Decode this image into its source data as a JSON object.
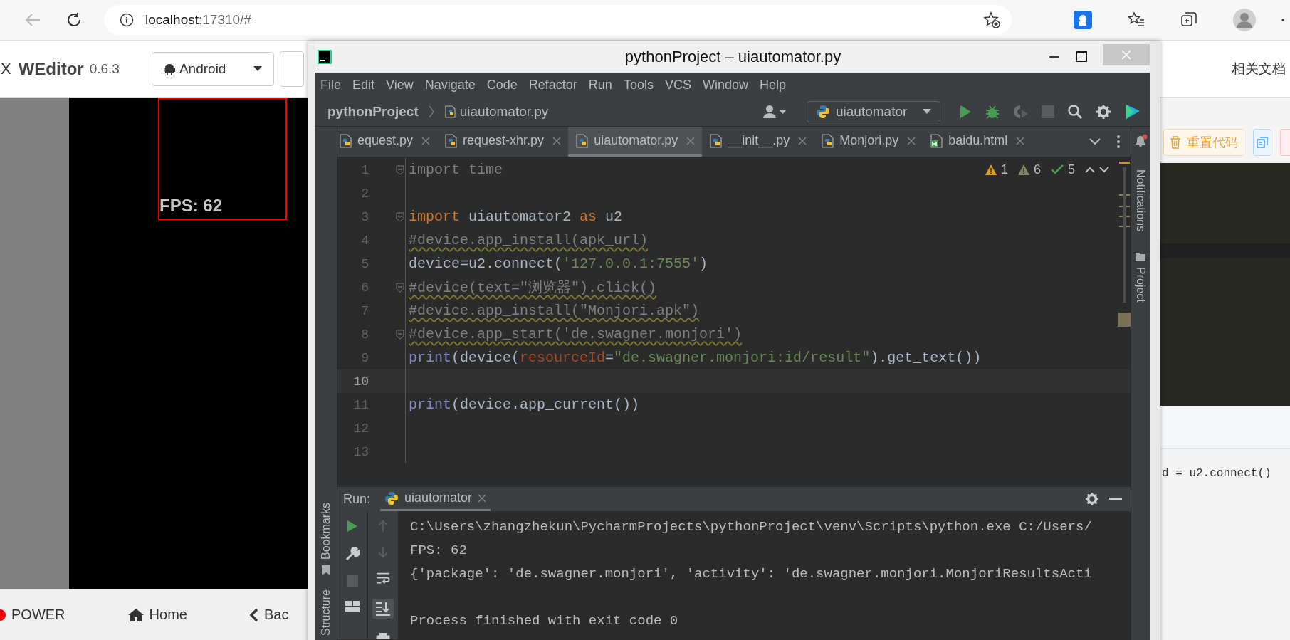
{
  "browser": {
    "back_disabled": true,
    "url_host": "localhost",
    "url_rest": ":17310/#"
  },
  "weditor": {
    "logo_fragment": "X",
    "title": "WEditor",
    "version": "0.6.3",
    "platform": "Android",
    "docs_link": "相关文档"
  },
  "device": {
    "fps_text": "FPS: 62",
    "nav_buttons": [
      {
        "kind": "power",
        "label": "POWER"
      },
      {
        "kind": "home",
        "label": "Home"
      },
      {
        "kind": "back",
        "label": "Bac"
      }
    ]
  },
  "code_panel": {
    "reset_button": "重置代码",
    "code_text": "d = u2.connect()"
  },
  "ide": {
    "title": "pythonProject – uiautomator.py",
    "menu": [
      "File",
      "Edit",
      "View",
      "Navigate",
      "Code",
      "Refactor",
      "Run",
      "Tools",
      "VCS",
      "Window",
      "Help"
    ],
    "breadcrumb": {
      "project": "pythonProject",
      "file": "uiautomator.py"
    },
    "run_config": "uiautomator",
    "tabs": [
      {
        "label": "equest.py",
        "kind": "python",
        "selected": false
      },
      {
        "label": "request-xhr.py",
        "kind": "python",
        "selected": false
      },
      {
        "label": "uiautomator.py",
        "kind": "python",
        "selected": true
      },
      {
        "label": "__init__.py",
        "kind": "python",
        "selected": false
      },
      {
        "label": "Monjori.py",
        "kind": "python",
        "selected": false
      },
      {
        "label": "baidu.html",
        "kind": "html",
        "selected": false
      }
    ],
    "inspections": {
      "warnings": "1",
      "weak_warnings": "6",
      "typos": "5"
    },
    "lines": [
      {
        "number": "1",
        "fold": true,
        "current": false,
        "tokens": [
          {
            "kind": "unused",
            "text": "import time"
          }
        ]
      },
      {
        "number": "2",
        "fold": false,
        "current": false
      },
      {
        "number": "3",
        "fold": true,
        "current": false,
        "tokens": [
          {
            "kind": "keyword",
            "text": "import"
          },
          {
            "kind": "plain",
            "text": " uiautomator2 "
          },
          {
            "kind": "keyword",
            "text": "as"
          },
          {
            "kind": "plain",
            "text": " u2"
          }
        ]
      },
      {
        "number": "4",
        "fold": false,
        "current": false,
        "tokens": [
          {
            "kind": "comment",
            "text": "#device.app_install(apk_url)"
          }
        ]
      },
      {
        "number": "5",
        "fold": false,
        "current": false,
        "tokens": [
          {
            "kind": "plain",
            "text": "device=u2.connect("
          },
          {
            "kind": "string",
            "text": "'127.0.0.1:7555'"
          },
          {
            "kind": "plain",
            "text": ")"
          }
        ]
      },
      {
        "number": "6",
        "fold": true,
        "current": false,
        "tokens": [
          {
            "kind": "comment",
            "text": "#device(text=\"浏览器\").click()"
          }
        ]
      },
      {
        "number": "7",
        "fold": false,
        "current": false,
        "tokens": [
          {
            "kind": "comment",
            "text": "#device.app_install(\"Monjori.apk\")"
          }
        ]
      },
      {
        "number": "8",
        "fold": true,
        "current": false,
        "tokens": [
          {
            "kind": "comment",
            "text": "#device.app_start('de.swagner.monjori')"
          }
        ]
      },
      {
        "number": "9",
        "fold": false,
        "current": false,
        "tokens": [
          {
            "kind": "builtin",
            "text": "print"
          },
          {
            "kind": "plain",
            "text": "(device("
          },
          {
            "kind": "param",
            "text": "resourceId"
          },
          {
            "kind": "plain",
            "text": "="
          },
          {
            "kind": "string",
            "text": "\"de.swagner.monjori:id/result\""
          },
          {
            "kind": "plain",
            "text": ").get_text())"
          }
        ]
      },
      {
        "number": "10",
        "fold": false,
        "current": true
      },
      {
        "number": "11",
        "fold": false,
        "current": false,
        "tokens": [
          {
            "kind": "builtin",
            "text": "print"
          },
          {
            "kind": "plain",
            "text": "(device.app_current())"
          }
        ]
      },
      {
        "number": "12",
        "fold": false,
        "current": false
      },
      {
        "number": "13",
        "fold": false,
        "current": false
      }
    ],
    "side_left": [
      "Bookmarks",
      "Structure"
    ],
    "side_right": [
      "Notifications",
      "Project"
    ],
    "run_panel": {
      "label": "Run:",
      "tab": "uiautomator",
      "output_blocks": [
        [
          "C:\\Users\\zhangzhekun\\PycharmProjects\\pythonProject\\venv\\Scripts\\python.exe C:/Users/",
          "FPS: 62",
          "{'package': 'de.swagner.monjori', 'activity': 'de.swagner.monjori.MonjoriResultsActi"
        ],
        [
          "Process finished with exit code 0"
        ]
      ]
    }
  }
}
